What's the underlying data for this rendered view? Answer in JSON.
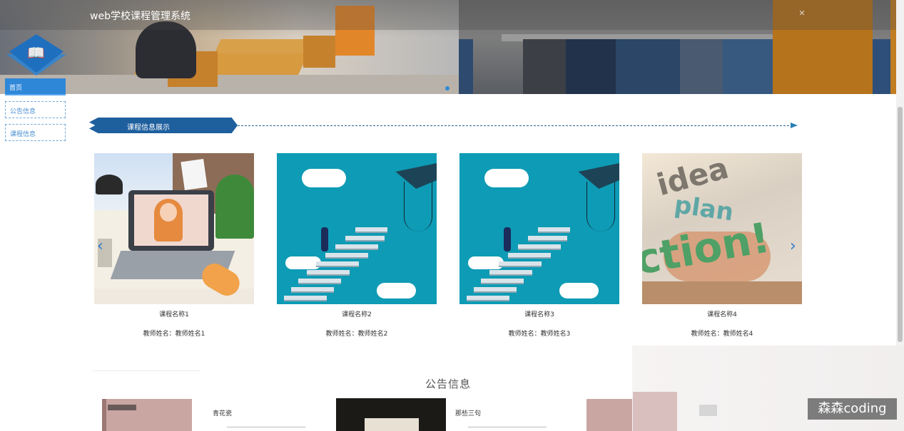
{
  "header": {
    "title": "web学校课程管理系统",
    "close_symbol": "✕"
  },
  "sidebar": {
    "items": [
      {
        "label": "首页"
      },
      {
        "label": "公告信息"
      },
      {
        "label": "课程信息"
      }
    ]
  },
  "course_section": {
    "title": "课程信息展示",
    "prev_symbol": "‹",
    "next_symbol": "›",
    "cards": [
      {
        "name": "课程名称1",
        "teacher": "教师姓名：教师姓名1"
      },
      {
        "name": "课程名称2",
        "teacher": "教师姓名：教师姓名2"
      },
      {
        "name": "课程名称3",
        "teacher": "教师姓名：教师姓名3"
      },
      {
        "name": "课程名称4",
        "teacher": "教师姓名：教师姓名4"
      }
    ]
  },
  "notice_section": {
    "title": "公告信息",
    "items": [
      {
        "title": "青花瓷"
      },
      {
        "title": "那些三句"
      }
    ]
  },
  "watermark": "森森coding",
  "colors": {
    "accent": "#2f87d8",
    "section_tag": "#1e5f9e"
  }
}
